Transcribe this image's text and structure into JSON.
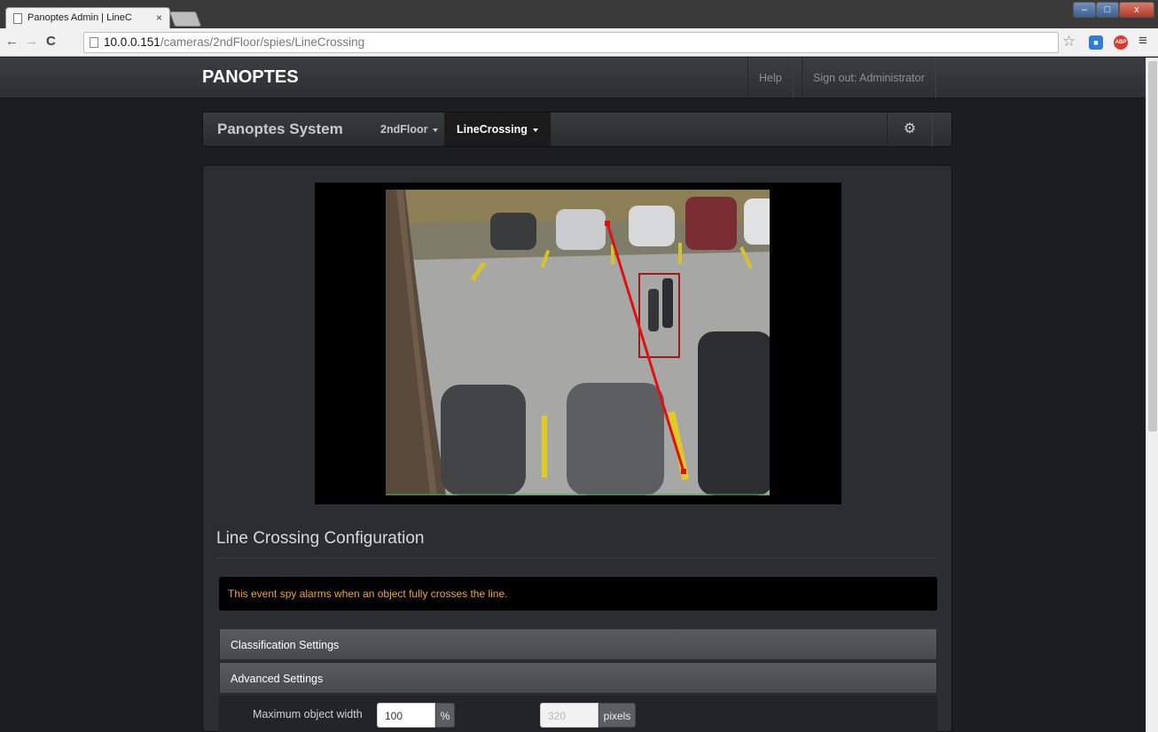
{
  "browser": {
    "tab_title": "Panoptes Admin | LineC",
    "tab_close": "×",
    "url_host": "10.0.0.151",
    "url_path": "/cameras/2ndFloor/spies/LineCrossing",
    "nav_back": "←",
    "nav_forward": "→",
    "nav_reload": "C",
    "star_icon": "☆",
    "menu_icon": "≡",
    "abp_label": "ABP"
  },
  "topnav": {
    "brand": "PANOPTES",
    "help": "Help",
    "signout": "Sign out: Administrator"
  },
  "subnav": {
    "title": "Panoptes System",
    "camera": "2ndFloor",
    "spy": "LineCrossing",
    "gear_icon": "⚙"
  },
  "main": {
    "section_title": "Line Crossing Configuration",
    "info": "This event spy alarms when an object fully crosses the line.",
    "accordion": [
      {
        "label": "Classification Settings"
      },
      {
        "label": "Advanced Settings"
      }
    ],
    "max_width": {
      "label": "Maximum object width",
      "percent_value": "100",
      "percent_unit": "%",
      "pixels_value": "320",
      "pixels_unit": "pixels"
    }
  }
}
